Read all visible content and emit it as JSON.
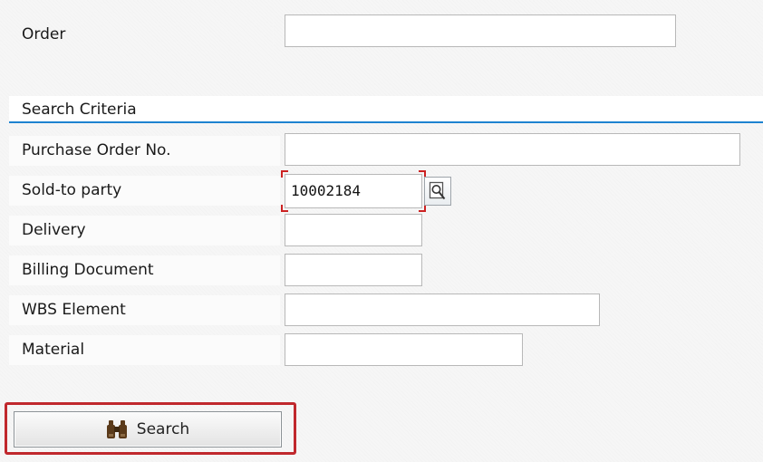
{
  "header_field": {
    "label": "Order",
    "value": ""
  },
  "section": {
    "title": "Search Criteria"
  },
  "criteria": {
    "purchase_order": {
      "label": "Purchase Order No.",
      "value": ""
    },
    "sold_to_party": {
      "label": "Sold-to party",
      "value": "10002184"
    },
    "delivery": {
      "label": "Delivery",
      "value": ""
    },
    "billing_document": {
      "label": "Billing Document",
      "value": ""
    },
    "wbs_element": {
      "label": "WBS Element",
      "value": ""
    },
    "material": {
      "label": "Material",
      "value": ""
    }
  },
  "actions": {
    "search_label": "Search"
  },
  "icons": {
    "value_help": "magnifier-icon",
    "search": "binoculars-icon"
  },
  "colors": {
    "section_underline": "#1e83d0",
    "focus_marker": "#cc2222",
    "highlight_border": "#c0282d",
    "binoculars": "#5a3a1a"
  }
}
